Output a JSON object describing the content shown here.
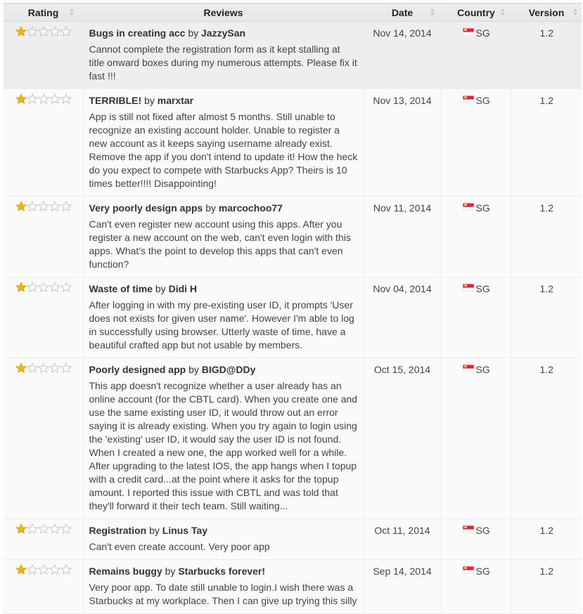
{
  "table": {
    "columns": [
      {
        "key": "rating",
        "label": "Rating",
        "sortable": true
      },
      {
        "key": "reviews",
        "label": "Reviews",
        "sortable": false
      },
      {
        "key": "date",
        "label": "Date",
        "sortable": true
      },
      {
        "key": "country",
        "label": "Country",
        "sortable": true
      },
      {
        "key": "version",
        "label": "Version",
        "sortable": true
      }
    ],
    "by_word": "by",
    "star_colors": {
      "filled": "#f5b400",
      "empty_stroke": "#b8b8b8"
    },
    "flag_colors": {
      "red": "#e8202a",
      "white": "#f8f8f8"
    },
    "rows": [
      {
        "rating": 1,
        "max_rating": 5,
        "title": "Bugs in creating acc",
        "author": "JazzySan",
        "body": "Cannot complete the registration form as it kept stalling at title onward boxes during my numerous attempts. Please fix it fast !!!",
        "date": "Nov 14, 2014",
        "country_icon": "singapore-flag-icon",
        "country": "SG",
        "version": "1.2",
        "highlighted": true
      },
      {
        "rating": 1,
        "max_rating": 5,
        "title": "TERRIBLE!",
        "author": "marxtar",
        "body": "App is still not fixed after almost 5 months. Still unable to recognize an existing account holder. Unable to register a new account as it keeps saying username already exist. Remove the app if you don't intend to update it! How the heck do you expect to compete with Starbucks App? Theirs is 10 times better!!!! Disappointing!",
        "date": "Nov 13, 2014",
        "country_icon": "singapore-flag-icon",
        "country": "SG",
        "version": "1.2",
        "highlighted": false
      },
      {
        "rating": 1,
        "max_rating": 5,
        "title": "Very poorly design apps",
        "author": "marcochoo77",
        "body": "Can't even register new account using this apps. After you register a new account on the web, can't even login with this apps. What's the point to develop this apps that can't even function?",
        "date": "Nov 11, 2014",
        "country_icon": "singapore-flag-icon",
        "country": "SG",
        "version": "1.2",
        "highlighted": false
      },
      {
        "rating": 1,
        "max_rating": 5,
        "title": "Waste of time",
        "author": "Didi H",
        "body": "After logging in with my pre-existing user ID, it prompts 'User does not exists for given user name'. However I'm able to log in successfully using browser. Utterly waste of time, have a beautiful crafted app but not usable by members.",
        "date": "Nov 04, 2014",
        "country_icon": "singapore-flag-icon",
        "country": "SG",
        "version": "1.2",
        "highlighted": false
      },
      {
        "rating": 1,
        "max_rating": 5,
        "title": "Poorly designed app",
        "author": "BIGD@DDy",
        "body": "This app doesn't recognize whether a user already has an online account (for the CBTL card). When you create one and use the same existing user ID, it would throw out an error saying it is already existing. When you try again to login using the 'existing' user ID, it would say the user ID is not found. When I created a new one, the app worked well for a while. After upgrading to the latest IOS, the app hangs when I topup with a credit card...at the point where it asks for the topup amount. I reported this issue with CBTL and was told that they'll forward it their tech team. Still waiting...",
        "date": "Oct 15, 2014",
        "country_icon": "singapore-flag-icon",
        "country": "SG",
        "version": "1.2",
        "highlighted": false
      },
      {
        "rating": 1,
        "max_rating": 5,
        "title": "Registration",
        "author": "Linus Tay",
        "body": "Can't even create account. Very poor app",
        "date": "Oct 11, 2014",
        "country_icon": "singapore-flag-icon",
        "country": "SG",
        "version": "1.2",
        "highlighted": false
      },
      {
        "rating": 1,
        "max_rating": 5,
        "title": "Remains buggy",
        "author": "Starbucks forever!",
        "body": "Very poor app. To date still unable to login.I wish there was a Starbucks at my workplace. Then I can give up trying this silly",
        "date": "Sep 14, 2014",
        "country_icon": "singapore-flag-icon",
        "country": "SG",
        "version": "1.2",
        "highlighted": false
      }
    ]
  }
}
